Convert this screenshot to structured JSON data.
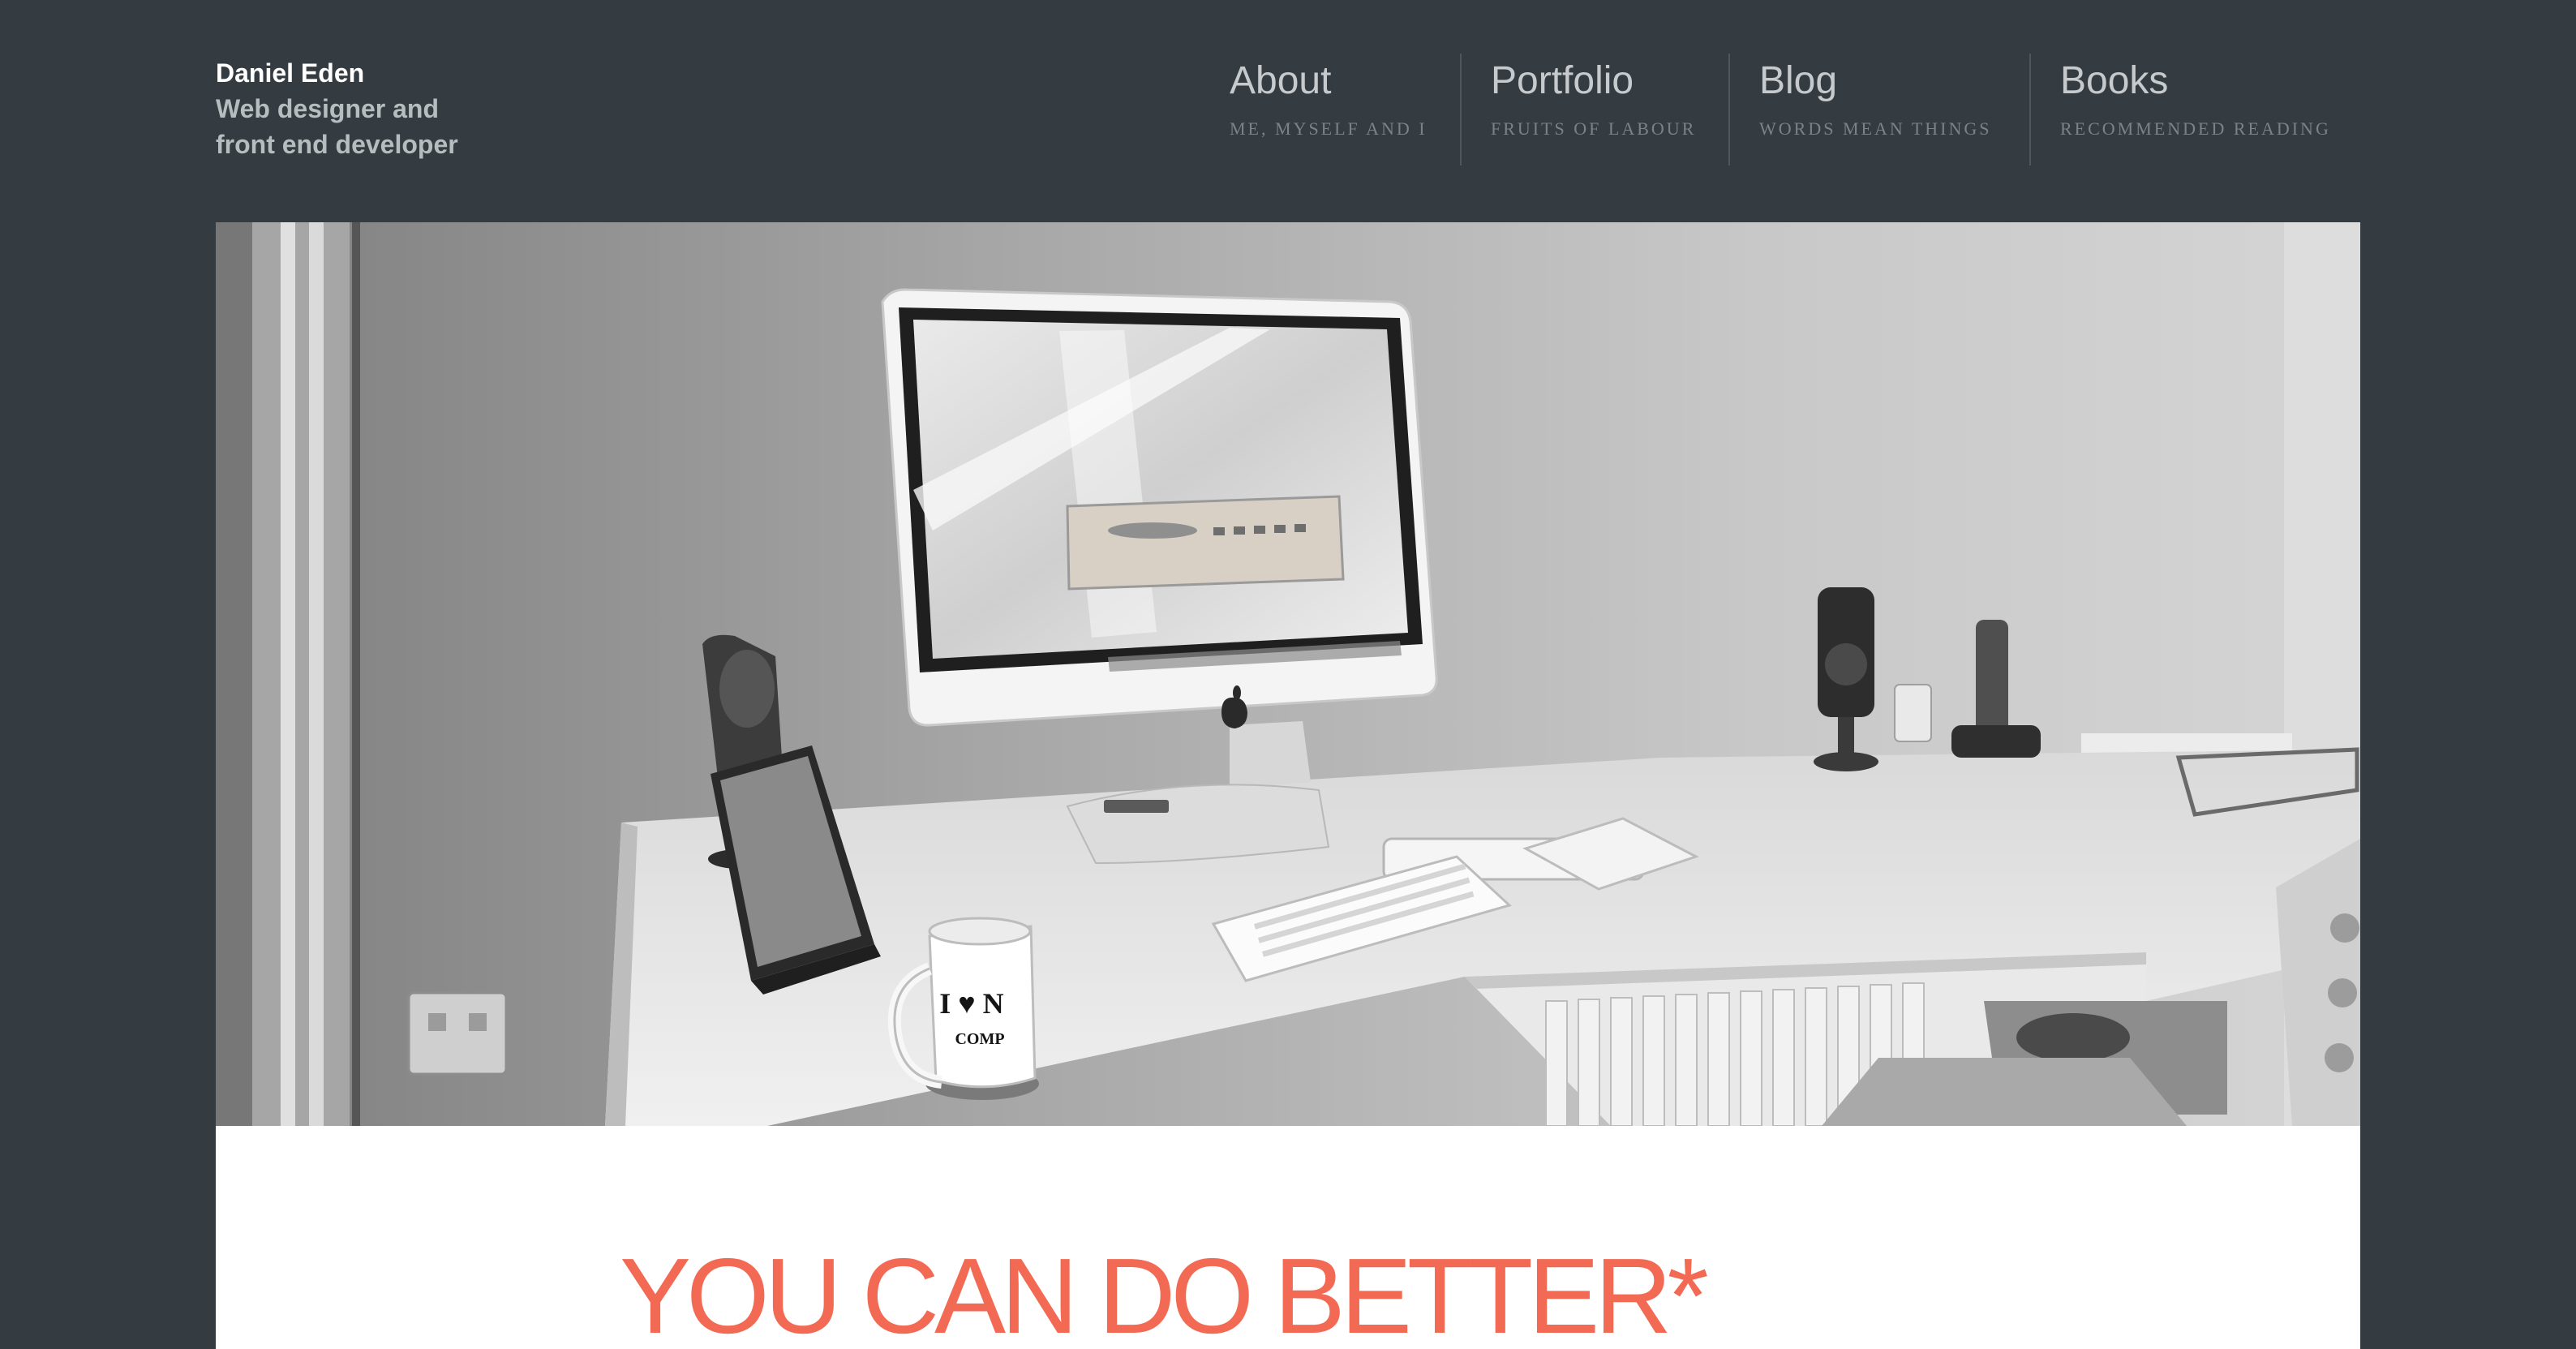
{
  "brand": {
    "name": "Daniel Eden",
    "tagline_line1": "Web designer and",
    "tagline_line2": "front end developer"
  },
  "nav": {
    "items": [
      {
        "title": "About",
        "subtitle": "ME, MYSELF AND I"
      },
      {
        "title": "Portfolio",
        "subtitle": "FRUITS OF LABOUR"
      },
      {
        "title": "Blog",
        "subtitle": "WORDS MEAN THINGS"
      },
      {
        "title": "Books",
        "subtitle": "RECOMMENDED READING"
      }
    ]
  },
  "hero": {
    "mug_text_line1": "I ♥ N",
    "mug_text_line2": "COMP"
  },
  "content": {
    "headline": "YOU CAN DO BETTER*"
  },
  "colors": {
    "header_background": "#343c41",
    "headline_accent": "#f26a53",
    "panel_background": "#ffffff"
  },
  "icons": {
    "apple_logo": "apple-logo-icon",
    "heart": "heart-icon"
  }
}
